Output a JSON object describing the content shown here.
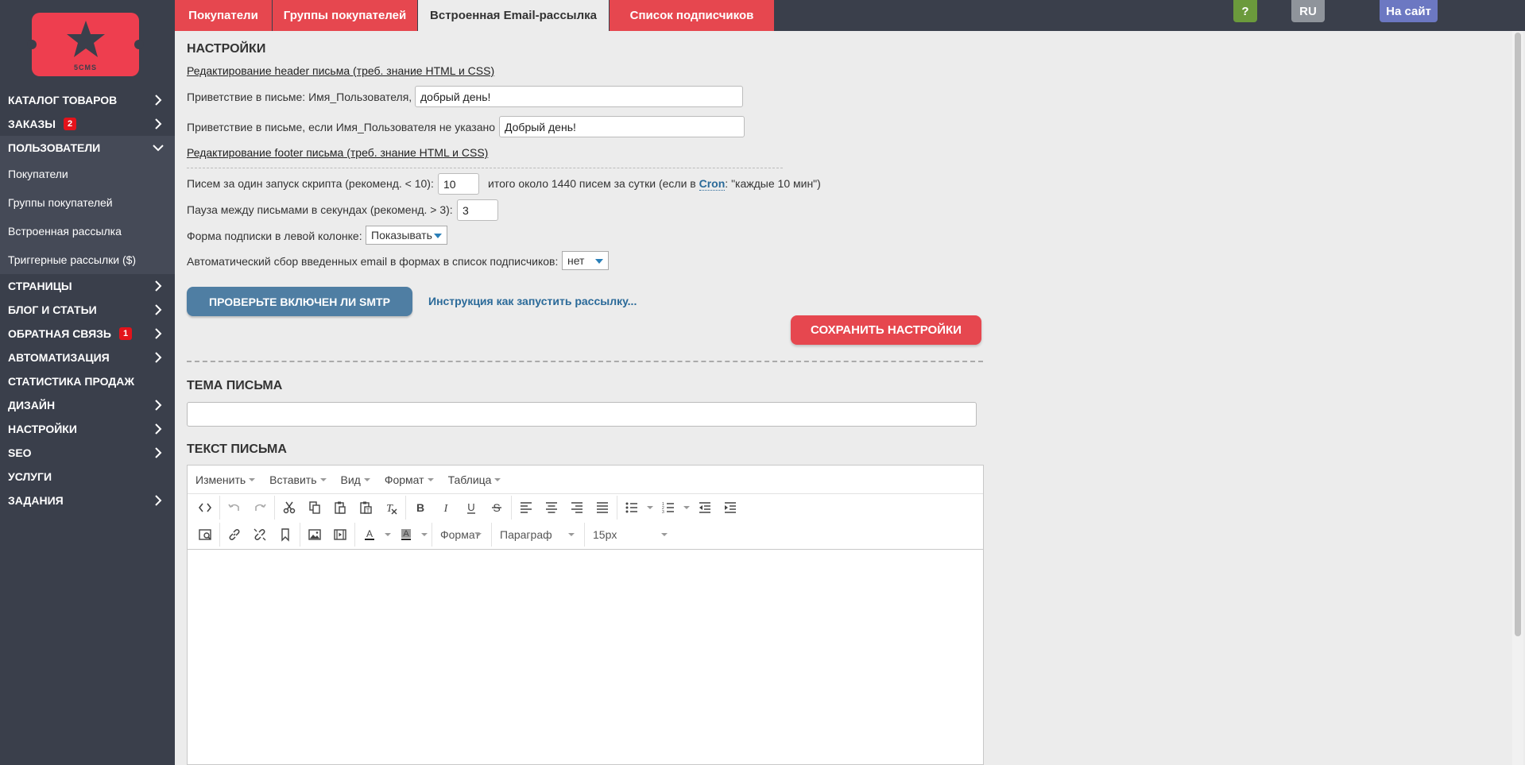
{
  "logo": {
    "text": "5CMS"
  },
  "colors": {
    "sidebar": "#3a3f4b",
    "accent_red": "#e6474f",
    "tab_active": "#ececec",
    "help_green": "#6b9a3c",
    "lang_gray": "#8f949b",
    "site_blue": "#6c78c2",
    "smtp_blue": "#4f7ea3",
    "badge_red": "#e3131b"
  },
  "sidebar": {
    "items": [
      {
        "label": "КАТАЛОГ ТОВАРОВ",
        "chevron": "right"
      },
      {
        "label": "ЗАКАЗЫ",
        "badge": "2",
        "chevron": "right"
      },
      {
        "label": "ПОЛЬЗОВАТЕЛИ",
        "chevron": "down"
      }
    ],
    "subitems": [
      {
        "label": "Покупатели"
      },
      {
        "label": "Группы покупателей"
      },
      {
        "label": "Встроенная рассылка"
      },
      {
        "label": "Триггерные рассылки ($)"
      }
    ],
    "items_after": [
      {
        "label": "СТРАНИЦЫ",
        "chevron": "right"
      },
      {
        "label": "БЛОГ И СТАТЬИ",
        "chevron": "right"
      },
      {
        "label": "ОБРАТНАЯ СВЯЗЬ",
        "badge": "1",
        "chevron": "right"
      },
      {
        "label": "АВТОМАТИЗАЦИЯ",
        "chevron": "right"
      },
      {
        "label": "СТАТИСТИКА ПРОДАЖ"
      },
      {
        "label": "ДИЗАЙН",
        "chevron": "right"
      },
      {
        "label": "НАСТРОЙКИ",
        "chevron": "right"
      },
      {
        "label": "SEO",
        "chevron": "right"
      },
      {
        "label": "УСЛУГИ"
      },
      {
        "label": "ЗАДАНИЯ",
        "chevron": "right"
      }
    ]
  },
  "tabs": [
    {
      "label": "Покупатели",
      "active": false
    },
    {
      "label": "Группы покупателей",
      "active": false
    },
    {
      "label": "Встроенная Email-рассылка",
      "active": true
    },
    {
      "label": "Список подписчиков",
      "active": false
    }
  ],
  "top_buttons": {
    "help": "?",
    "lang": "RU",
    "site": "На сайт"
  },
  "settings": {
    "title": "НАСТРОЙКИ",
    "header_link": "Редактирование header письма (треб. знание HTML и CSS)",
    "greeting_label": "Приветствие в письме: Имя_Пользователя,",
    "greeting_value": "добрый день!",
    "greeting_noname_label": "Приветствие в письме, если Имя_Пользователя не указано",
    "greeting_noname_value": "Добрый день!",
    "footer_link": "Редактирование footer письма (треб. знание HTML и CSS)",
    "per_run_label": "Писем за один запуск скрипта (рекоменд. < 10):",
    "per_run_value": "10",
    "per_day_text_pre": "итого около 1440 писем за сутки (если в",
    "cron_link": "Cron",
    "per_day_text_post": ": \"каждые 10 мин\")",
    "pause_label": "Пауза между письмами в секундах (рекоменд. > 3):",
    "pause_value": "3",
    "subscribe_form_label": "Форма подписки в левой колонке:",
    "subscribe_form_value": "Показывать",
    "auto_collect_label": "Автоматический сбор введенных email в формах в список подписчиков:",
    "auto_collect_value": "нет",
    "smtp_button": "ПРОВЕРЬТЕ ВКЛЮЧЕН ЛИ SMTP",
    "instruction_link": "Инструкция как запустить рассылку...",
    "save_button": "СОХРАНИТЬ НАСТРОЙКИ"
  },
  "letter": {
    "subject_title": "ТЕМА ПИСЬМА",
    "subject_value": "",
    "body_title": "ТЕКСТ ПИСЬМА"
  },
  "editor": {
    "menu": [
      "Изменить",
      "Вставить",
      "Вид",
      "Формат",
      "Таблица"
    ],
    "format_combo": "Формат",
    "paragraph_combo": "Параграф",
    "size_combo": "15px"
  }
}
